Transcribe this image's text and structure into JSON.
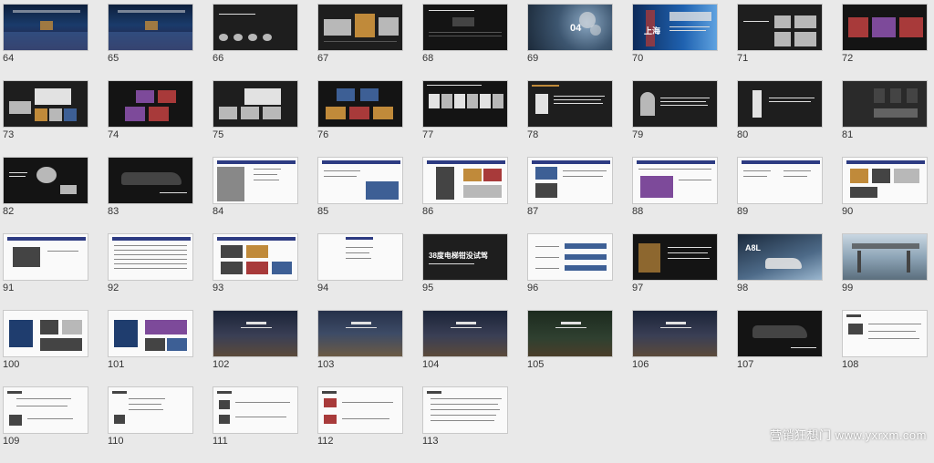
{
  "slides": [
    {
      "n": "64",
      "theme": "stage"
    },
    {
      "n": "65",
      "theme": "stage"
    },
    {
      "n": "66",
      "theme": "dark2"
    },
    {
      "n": "67",
      "theme": "dark2"
    },
    {
      "n": "68",
      "theme": "dark"
    },
    {
      "n": "69",
      "theme": "bokeh",
      "title": "04"
    },
    {
      "n": "70",
      "theme": "blue",
      "title": "上海"
    },
    {
      "n": "71",
      "theme": "dark2"
    },
    {
      "n": "72",
      "theme": "dark"
    },
    {
      "n": "73",
      "theme": "dark2"
    },
    {
      "n": "74",
      "theme": "dark"
    },
    {
      "n": "75",
      "theme": "dark2"
    },
    {
      "n": "76",
      "theme": "dark"
    },
    {
      "n": "77",
      "theme": "dark"
    },
    {
      "n": "78",
      "theme": "dark2"
    },
    {
      "n": "79",
      "theme": "dark2"
    },
    {
      "n": "80",
      "theme": "dark2"
    },
    {
      "n": "81",
      "theme": "grey"
    },
    {
      "n": "82",
      "theme": "dark"
    },
    {
      "n": "83",
      "theme": "dark"
    },
    {
      "n": "84",
      "theme": "white"
    },
    {
      "n": "85",
      "theme": "white"
    },
    {
      "n": "86",
      "theme": "white"
    },
    {
      "n": "87",
      "theme": "white"
    },
    {
      "n": "88",
      "theme": "white"
    },
    {
      "n": "89",
      "theme": "white"
    },
    {
      "n": "90",
      "theme": "white"
    },
    {
      "n": "91",
      "theme": "white"
    },
    {
      "n": "92",
      "theme": "white"
    },
    {
      "n": "93",
      "theme": "white"
    },
    {
      "n": "94",
      "theme": "white"
    },
    {
      "n": "95",
      "theme": "dark2",
      "title": "38度电梯钳没试驾"
    },
    {
      "n": "96",
      "theme": "white"
    },
    {
      "n": "97",
      "theme": "dark"
    },
    {
      "n": "98",
      "theme": "car",
      "title": "A8L"
    },
    {
      "n": "99",
      "theme": "arch"
    },
    {
      "n": "100",
      "theme": "white"
    },
    {
      "n": "101",
      "theme": "white"
    },
    {
      "n": "102",
      "theme": "night"
    },
    {
      "n": "103",
      "theme": "city"
    },
    {
      "n": "104",
      "theme": "night"
    },
    {
      "n": "105",
      "theme": "green"
    },
    {
      "n": "106",
      "theme": "night"
    },
    {
      "n": "107",
      "theme": "dark"
    },
    {
      "n": "108",
      "theme": "white"
    },
    {
      "n": "109",
      "theme": "white"
    },
    {
      "n": "110",
      "theme": "white"
    },
    {
      "n": "111",
      "theme": "white"
    },
    {
      "n": "112",
      "theme": "white"
    },
    {
      "n": "113",
      "theme": "white"
    }
  ],
  "watermark": "营销狂想门 www.yxrxm.com",
  "colors": {
    "background": "#e9e9e9",
    "accent": "#2d3b82",
    "label": "#333333"
  }
}
